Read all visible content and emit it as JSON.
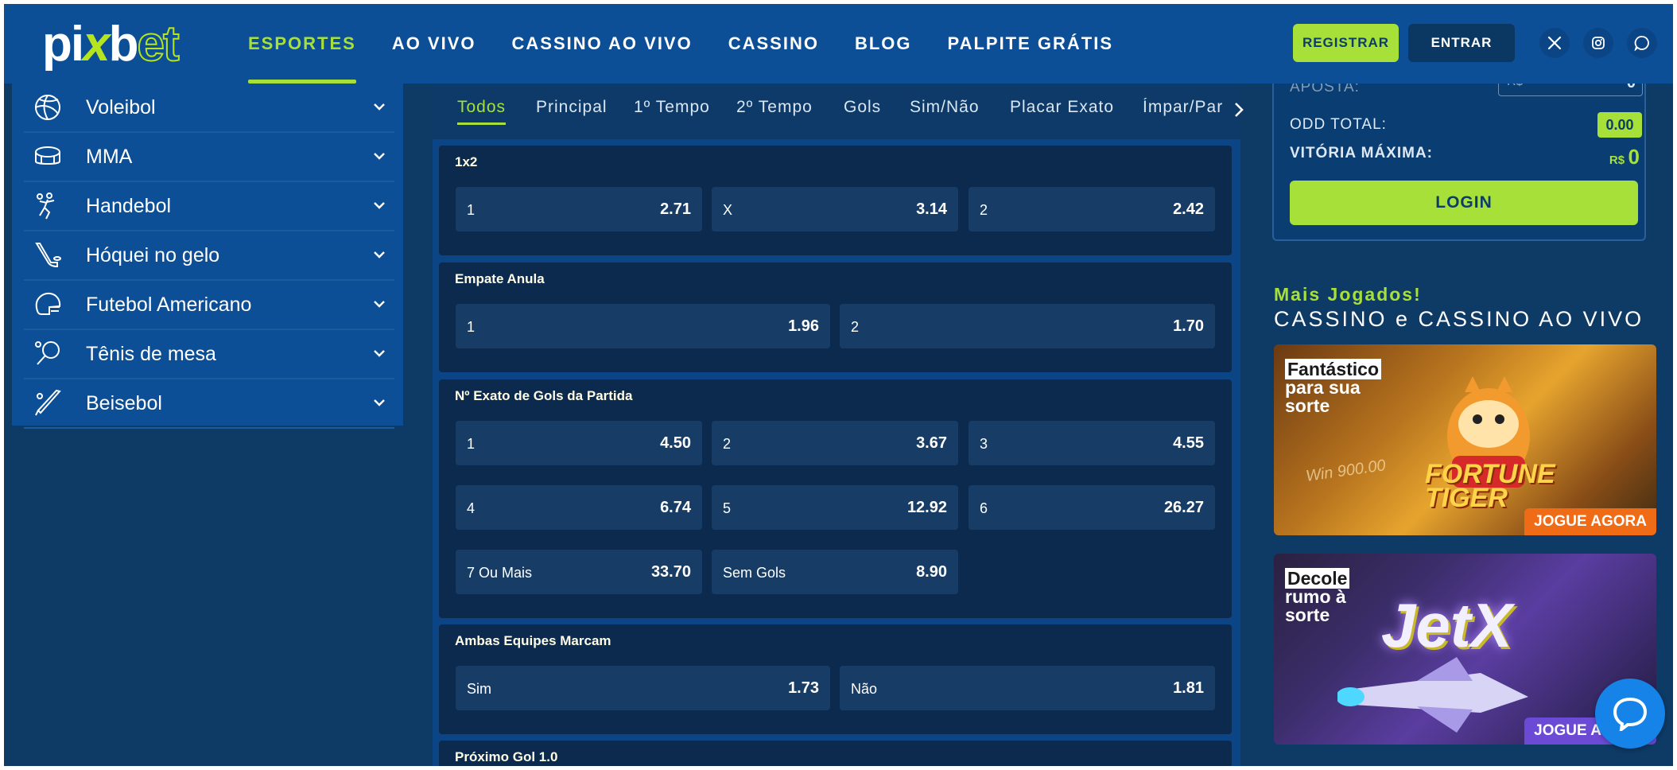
{
  "header": {
    "logo": {
      "part1": "pi",
      "part2": "x",
      "part3": "b",
      "part4": "et"
    },
    "nav": [
      {
        "label": "ESPORTES",
        "active": true
      },
      {
        "label": "AO VIVO"
      },
      {
        "label": "CASSINO AO VIVO"
      },
      {
        "label": "CASSINO"
      },
      {
        "label": "BLOG"
      },
      {
        "label": "PALPITE GRÁTIS"
      }
    ],
    "register_label": "REGISTRAR",
    "login_label": "ENTRAR",
    "social": [
      "x-icon",
      "instagram-icon",
      "whatsapp-icon"
    ]
  },
  "sidebar": {
    "items": [
      {
        "label": "Voleibol",
        "icon": "volleyball-icon"
      },
      {
        "label": "MMA",
        "icon": "mma-ring-icon"
      },
      {
        "label": "Handebol",
        "icon": "handball-icon"
      },
      {
        "label": "Hóquei no gelo",
        "icon": "hockey-icon"
      },
      {
        "label": "Futebol Americano",
        "icon": "football-helmet-icon"
      },
      {
        "label": "Tênis de mesa",
        "icon": "table-tennis-icon"
      },
      {
        "label": "Beisebol",
        "icon": "baseball-icon"
      }
    ]
  },
  "tabs": [
    "Todos",
    "Principal",
    "1º Tempo",
    "2º Tempo",
    "Gols",
    "Sim/Não",
    "Placar Exato",
    "Ímpar/Par"
  ],
  "markets": [
    {
      "title": "1x2",
      "odds": [
        {
          "label": "1",
          "value": "2.71"
        },
        {
          "label": "X",
          "value": "3.14"
        },
        {
          "label": "2",
          "value": "2.42"
        }
      ]
    },
    {
      "title": "Empate Anula",
      "odds": [
        {
          "label": "1",
          "value": "1.96"
        },
        {
          "label": "2",
          "value": "1.70"
        }
      ]
    },
    {
      "title": "Nº Exato de Gols da Partida",
      "odds": [
        {
          "label": "1",
          "value": "4.50"
        },
        {
          "label": "2",
          "value": "3.67"
        },
        {
          "label": "3",
          "value": "4.55"
        },
        {
          "label": "4",
          "value": "6.74"
        },
        {
          "label": "5",
          "value": "12.92"
        },
        {
          "label": "6",
          "value": "26.27"
        },
        {
          "label": "7 Ou Mais",
          "value": "33.70"
        },
        {
          "label": "Sem Gols",
          "value": "8.90"
        }
      ]
    },
    {
      "title": "Ambas Equipes Marcam",
      "odds": [
        {
          "label": "Sim",
          "value": "1.73"
        },
        {
          "label": "Não",
          "value": "1.81"
        }
      ]
    },
    {
      "title": "Próximo Gol 1.0"
    }
  ],
  "betslip": {
    "aposta_label": "APOSTA:",
    "currency_placeholder": "R$",
    "aposta_value": "0",
    "odd_total_label": "ODD TOTAL:",
    "odd_total_value": "0.00",
    "vitoria_label": "VITÓRIA MÁXIMA:",
    "vitoria_currency": "R$",
    "vitoria_value": "0",
    "login_button": "LOGIN"
  },
  "casino": {
    "heading": "Mais Jogados!",
    "subheading": "CASSINO e CASSINO AO VIVO",
    "games": [
      {
        "tag_hl": "Fantástico",
        "tag_rest": "para sua sorte",
        "title": "FORTUNE TIGER",
        "cta": "JOGUE AGORA",
        "win": "Win 900.00"
      },
      {
        "tag_hl": "Decole",
        "tag_rest": "rumo à sorte",
        "title": "JetX",
        "cta": "JOGUE AGORA"
      }
    ]
  },
  "colors": {
    "accent": "#a8e03a",
    "header": "#0d4f96",
    "bg": "#0e3a66",
    "market": "#0b2a4d",
    "odd": "#173d66"
  }
}
